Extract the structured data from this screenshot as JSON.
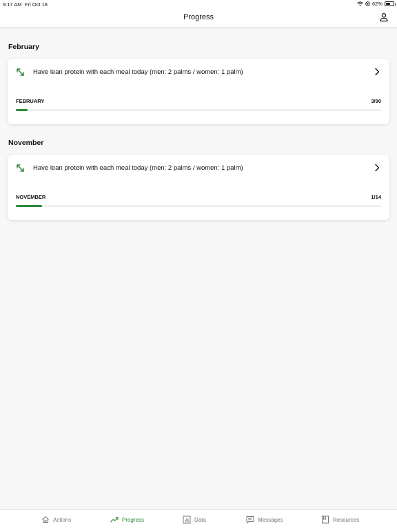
{
  "status_bar": {
    "time": "9:17 AM",
    "date": "Fri Oct 18",
    "battery": "62%",
    "battery_level": 0.62
  },
  "header": {
    "title": "Progress",
    "profile_icon": "person-icon"
  },
  "sections": [
    {
      "title": "February",
      "goal": "Have lean protein with each meal today (men: 2 palms / women: 1 palm)",
      "period_label": "FEBRUARY",
      "count": "3/90",
      "progress": 0.033
    },
    {
      "title": "November",
      "goal": "Have lean protein with each meal today (men: 2 palms / women: 1 palm)",
      "period_label": "NOVEMBER",
      "count": "1/14",
      "progress": 0.071
    }
  ],
  "tabs": [
    {
      "label": "Actions",
      "icon": "home-icon",
      "active": false
    },
    {
      "label": "Progress",
      "icon": "trending-up-icon",
      "active": true
    },
    {
      "label": "Data",
      "icon": "bar-chart-icon",
      "active": false
    },
    {
      "label": "Messages",
      "icon": "message-icon",
      "active": false
    },
    {
      "label": "Resources",
      "icon": "book-icon",
      "active": false
    }
  ],
  "colors": {
    "accent": "#2f8a3a",
    "background": "#f7f7f7",
    "card": "#ffffff",
    "inactive_tab": "#777777"
  }
}
